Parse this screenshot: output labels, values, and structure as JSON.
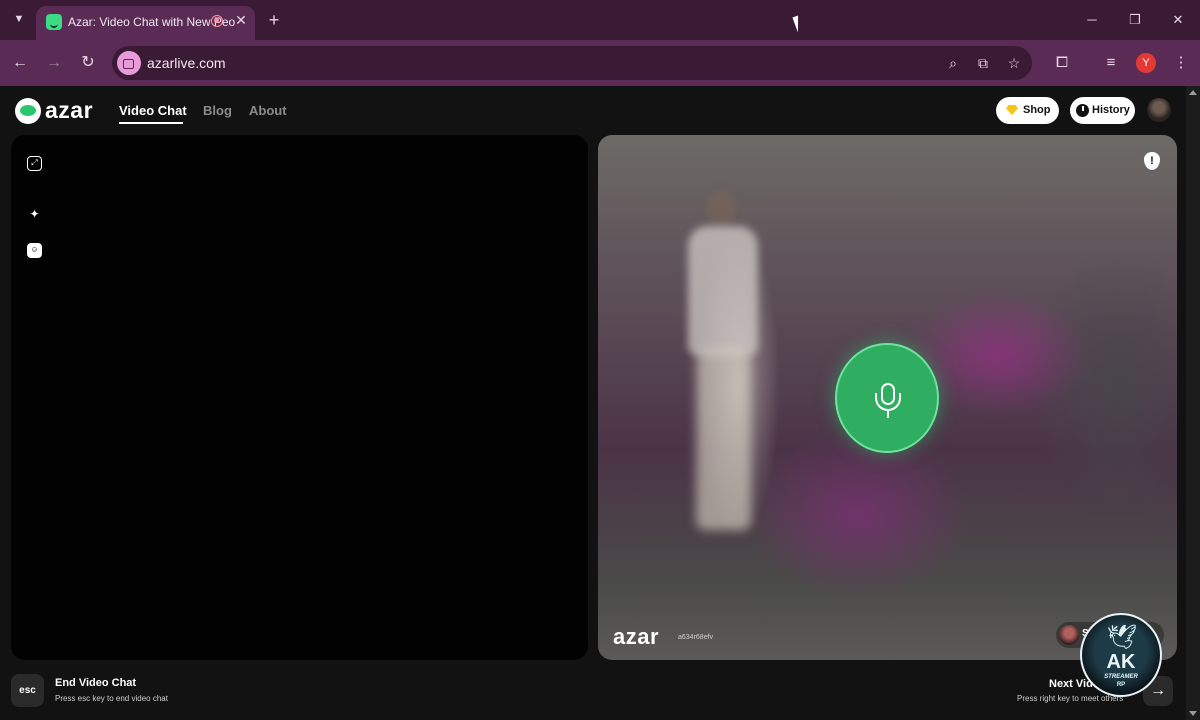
{
  "browser": {
    "tab": {
      "title": "Azar: Video Chat with New People",
      "favicon": "azar-smile-icon"
    },
    "url": "azarlive.com",
    "profile_initial": "Y",
    "colors": {
      "tabbar": "#3a1b35",
      "toolbar": "#5a2c55"
    }
  },
  "site": {
    "logo_text": "azar",
    "nav": [
      {
        "label": "Video Chat",
        "active": true
      },
      {
        "label": "Blog",
        "active": false
      },
      {
        "label": "About",
        "active": false
      }
    ],
    "shop_label": "Shop",
    "history_label": "History",
    "accent": "#28c76f"
  },
  "right_panel": {
    "watermark": "azar",
    "watermark_id": "a634r68efv",
    "peer_name": "S"
  },
  "bottom": {
    "esc_key": "esc",
    "end_title": "End Video Chat",
    "end_sub": "Press esc key to end video chat",
    "next_title": "Next Vid",
    "next_sub": "Press right key to meet others",
    "next_arrow": "→"
  },
  "badge": {
    "big": "AK",
    "small": "STREAMER",
    "tiny": "RP"
  }
}
